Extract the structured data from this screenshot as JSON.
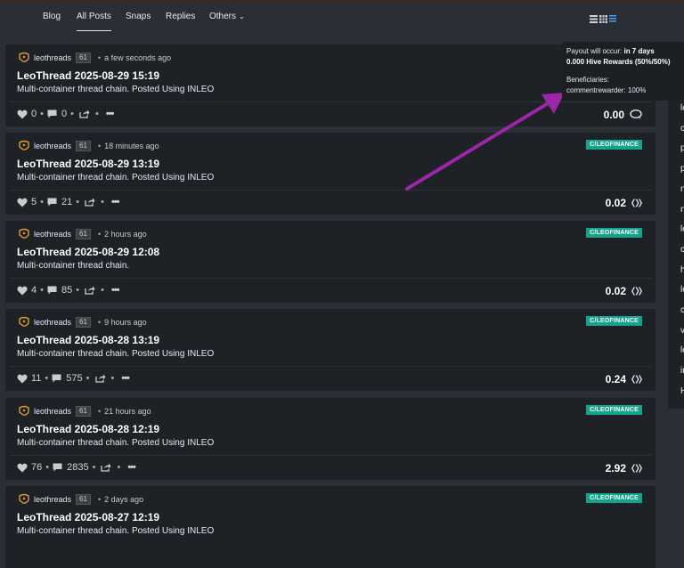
{
  "nav": {
    "items": [
      {
        "label": "Blog"
      },
      {
        "label": "All Posts",
        "active": true
      },
      {
        "label": "Snaps"
      },
      {
        "label": "Replies"
      },
      {
        "label": "Others",
        "caret": "⌄"
      }
    ],
    "view_icons": [
      "list-icon",
      "grid-icon",
      "compact-list-icon"
    ]
  },
  "posts": [
    {
      "author": "leothreads",
      "rep": "61",
      "ago": "a few seconds ago",
      "community": "",
      "title": "LeoThread 2025-08-29 15:19",
      "body": "Multi-container thread chain. Posted Using INLEO",
      "likes": "0",
      "comments": "0",
      "payout": "0.00",
      "payout_icon": "comment-reward-icon"
    },
    {
      "author": "leothreads",
      "rep": "61",
      "ago": "18 minutes ago",
      "community": "C/LEOFINANCE",
      "title": "LeoThread 2025-08-29 13:19",
      "body": "Multi-container thread chain. Posted Using INLEO",
      "likes": "5",
      "comments": "21",
      "payout": "0.02",
      "payout_icon": "hive-icon"
    },
    {
      "author": "leothreads",
      "rep": "61",
      "ago": "2 hours ago",
      "community": "C/LEOFINANCE",
      "title": "LeoThread 2025-08-29 12:08",
      "body": "Multi-container thread chain.",
      "likes": "4",
      "comments": "85",
      "payout": "0.02",
      "payout_icon": "hive-icon"
    },
    {
      "author": "leothreads",
      "rep": "61",
      "ago": "9 hours ago",
      "community": "C/LEOFINANCE",
      "title": "LeoThread 2025-08-28 13:19",
      "body": "Multi-container thread chain. Posted Using INLEO",
      "likes": "11",
      "comments": "575",
      "payout": "0.24",
      "payout_icon": "hive-icon"
    },
    {
      "author": "leothreads",
      "rep": "61",
      "ago": "21 hours ago",
      "community": "C/LEOFINANCE",
      "title": "LeoThread 2025-08-28 12:19",
      "body": "Multi-container thread chain. Posted Using INLEO",
      "likes": "76",
      "comments": "2835",
      "payout": "2.92",
      "payout_icon": "hive-icon"
    },
    {
      "author": "leothreads",
      "rep": "61",
      "ago": "2 days ago",
      "community": "C/LEOFINANCE",
      "title": "LeoThread 2025-08-27 12:19",
      "body": "Multi-container thread chain. Posted Using INLEO",
      "likes": "",
      "comments": "",
      "payout": "",
      "payout_icon": ""
    }
  ],
  "tooltip": {
    "payout_prefix": "Payout will occur: ",
    "payout_when": "in 7 days",
    "rewards": "0.000 Hive Rewards (50%/50%)",
    "beneficiaries_label": "Beneficiaries:",
    "beneficiary": "commentrewarder: 100%"
  },
  "right_sidebar_letters": [
    "le",
    "c",
    "p",
    "p",
    "n",
    "n",
    "le",
    "c",
    "h",
    "le",
    "c",
    "v",
    "le",
    "ir",
    "H"
  ],
  "colors": {
    "accent_community": "#14a38b",
    "annotation_arrow": "#9b26a6",
    "active_view_icon": "#3fa0ff"
  }
}
